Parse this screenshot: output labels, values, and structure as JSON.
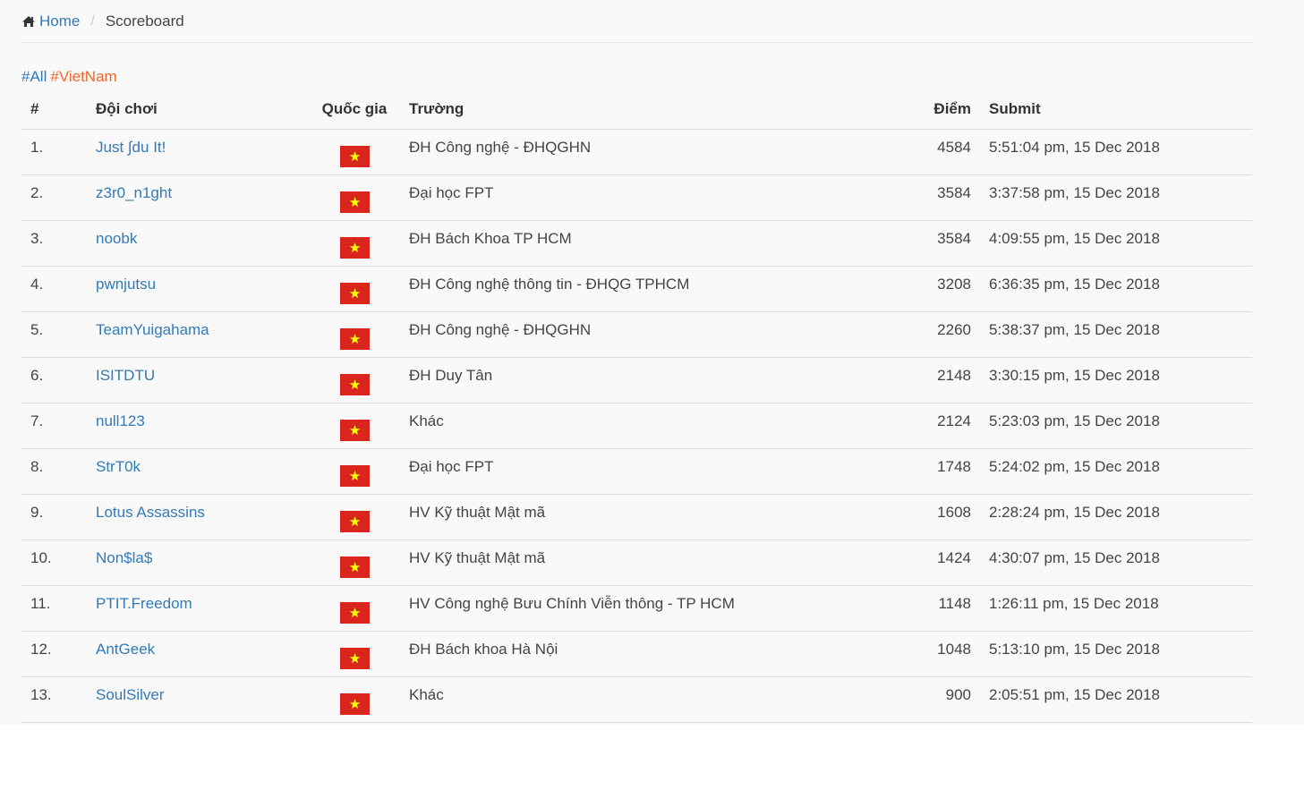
{
  "breadcrumb": {
    "home_label": "Home",
    "separator": "/",
    "current": "Scoreboard"
  },
  "filters": {
    "all": "#All",
    "vietnam": "#VietNam"
  },
  "table": {
    "headers": {
      "rank": "#",
      "team": "Đội chơi",
      "country": "Quốc gia",
      "school": "Trường",
      "score": "Điểm",
      "submit": "Submit"
    },
    "rows": [
      {
        "rank": "1.",
        "team": "Just ∫du It!",
        "country_flag": "vietnam-flag-icon",
        "school": "ĐH Công nghệ - ĐHQGHN",
        "score": "4584",
        "submit": "5:51:04 pm, 15 Dec 2018"
      },
      {
        "rank": "2.",
        "team": "z3r0_n1ght",
        "country_flag": "vietnam-flag-icon",
        "school": "Đại học FPT",
        "score": "3584",
        "submit": "3:37:58 pm, 15 Dec 2018"
      },
      {
        "rank": "3.",
        "team": "noobk",
        "country_flag": "vietnam-flag-icon",
        "school": "ĐH Bách Khoa TP HCM",
        "score": "3584",
        "submit": "4:09:55 pm, 15 Dec 2018"
      },
      {
        "rank": "4.",
        "team": "pwnjutsu",
        "country_flag": "vietnam-flag-icon",
        "school": "ĐH Công nghệ thông tin - ĐHQG TPHCM",
        "score": "3208",
        "submit": "6:36:35 pm, 15 Dec 2018"
      },
      {
        "rank": "5.",
        "team": "TeamYuigahama",
        "country_flag": "vietnam-flag-icon",
        "school": "ĐH Công nghệ - ĐHQGHN",
        "score": "2260",
        "submit": "5:38:37 pm, 15 Dec 2018"
      },
      {
        "rank": "6.",
        "team": "ISITDTU",
        "country_flag": "vietnam-flag-icon",
        "school": "ĐH Duy Tân",
        "score": "2148",
        "submit": "3:30:15 pm, 15 Dec 2018"
      },
      {
        "rank": "7.",
        "team": "null123",
        "country_flag": "vietnam-flag-icon",
        "school": "Khác",
        "score": "2124",
        "submit": "5:23:03 pm, 15 Dec 2018"
      },
      {
        "rank": "8.",
        "team": "StrT0k",
        "country_flag": "vietnam-flag-icon",
        "school": "Đại học FPT",
        "score": "1748",
        "submit": "5:24:02 pm, 15 Dec 2018"
      },
      {
        "rank": "9.",
        "team": "Lotus Assassins",
        "country_flag": "vietnam-flag-icon",
        "school": "HV Kỹ thuật Mật mã",
        "score": "1608",
        "submit": "2:28:24 pm, 15 Dec 2018"
      },
      {
        "rank": "10.",
        "team": "Non$la$",
        "country_flag": "vietnam-flag-icon",
        "school": "HV Kỹ thuật Mật mã",
        "score": "1424",
        "submit": "4:30:07 pm, 15 Dec 2018"
      },
      {
        "rank": "11.",
        "team": "PTIT.Freedom",
        "country_flag": "vietnam-flag-icon",
        "school": "HV Công nghệ Bưu Chính Viễn thông - TP HCM",
        "score": "1148",
        "submit": "1:26:11 pm, 15 Dec 2018"
      },
      {
        "rank": "12.",
        "team": "AntGeek",
        "country_flag": "vietnam-flag-icon",
        "school": "ĐH Bách khoa Hà Nội",
        "score": "1048",
        "submit": "5:13:10 pm, 15 Dec 2018"
      },
      {
        "rank": "13.",
        "team": "SoulSilver",
        "country_flag": "vietnam-flag-icon",
        "school": "Khác",
        "score": "900",
        "submit": "2:05:51 pm, 15 Dec 2018"
      }
    ]
  },
  "colors": {
    "link": "#337ab7",
    "filter_vietnam": "#f0662b",
    "flag_red": "#da251d",
    "flag_star": "#ffff00",
    "page_background": "#f9f9f9"
  }
}
